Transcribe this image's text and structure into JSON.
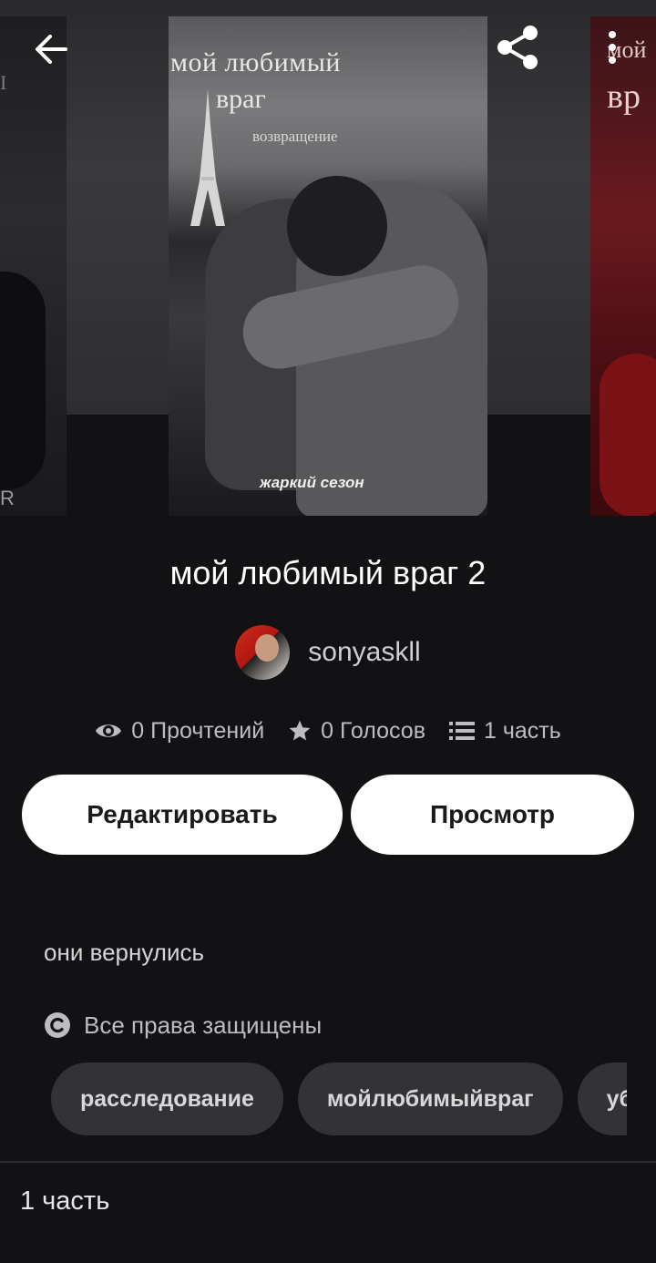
{
  "story": {
    "title": "мой любимый враг 2",
    "author": "sonyaskll",
    "cover_title_line1": "мой любимый",
    "cover_title_line2": "враг",
    "cover_subtitle": "возвращение",
    "cover_tagline": "жаркий сезон",
    "description": "они вернулись",
    "copyright": "Все права защищены"
  },
  "side_covers": {
    "left_letter_top": "I",
    "left_letter_bottom": "R",
    "right_line1": "мой",
    "right_line2": "вр"
  },
  "stats": {
    "reads": "0 Прочтений",
    "votes": "0 Голосов",
    "parts": "1 часть"
  },
  "actions": {
    "edit_label": "Редактировать",
    "view_label": "Просмотр"
  },
  "tags": [
    "расследование",
    "мойлюбимыйвраг",
    "убийство"
  ],
  "footer": {
    "parts_label": "1 часть"
  },
  "icons": {
    "back": "arrow-left-icon",
    "share": "share-icon",
    "more": "more-vertical-icon",
    "reads": "eye-icon",
    "votes": "star-icon",
    "parts": "list-icon",
    "copyright": "copyright-icon"
  },
  "colors": {
    "background": "#121214",
    "button_bg": "#ffffff",
    "tag_bg": "#333336",
    "text_secondary": "#bdbdc0"
  }
}
